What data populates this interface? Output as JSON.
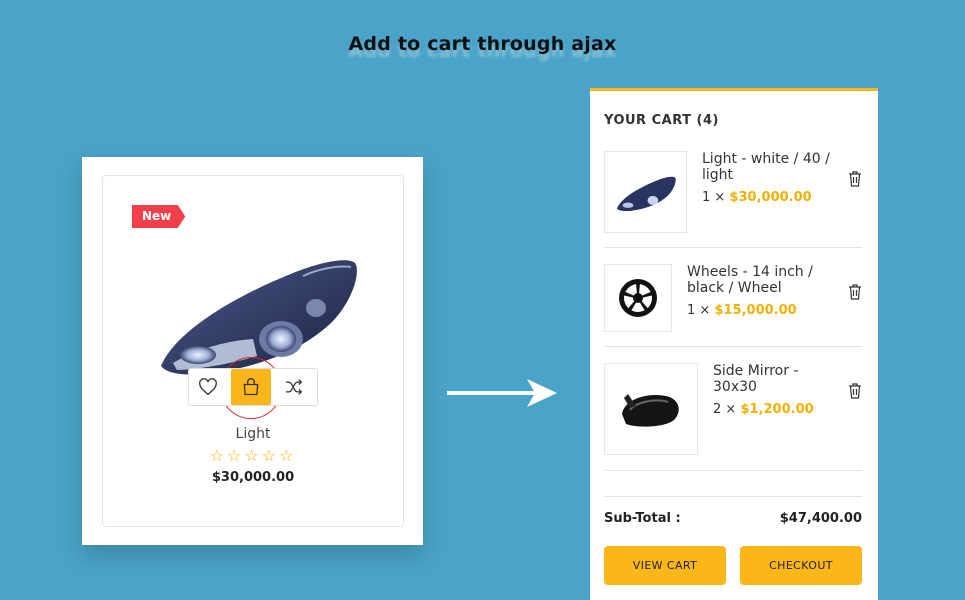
{
  "headline": "Add to cart through ajax",
  "product": {
    "badge": "New",
    "name": "Light",
    "stars": "☆☆☆☆☆",
    "price": "$30,000.00",
    "rating": 0,
    "actions": [
      "heart-icon",
      "shopping-bag-icon",
      "shuffle-icon"
    ]
  },
  "cart": {
    "title": "YOUR CART (4)",
    "items": [
      {
        "name": "Light - white / 40 / light",
        "qty": "1",
        "times": "×",
        "price": "$30,000.00",
        "image": "headlight"
      },
      {
        "name": "Wheels - 14 inch / black / Wheel",
        "qty": "1",
        "times": "×",
        "price": "$15,000.00",
        "image": "wheel"
      },
      {
        "name": "Side Mirror - 30x30",
        "qty": "2",
        "times": "×",
        "price": "$1,200.00",
        "image": "side-mirror"
      }
    ],
    "subtotal_label": "Sub-Total :",
    "subtotal_value": "$47,400.00",
    "view_cart_label": "VIEW CART",
    "checkout_label": "CHECKOUT"
  },
  "colors": {
    "background": "#4aa3c8",
    "accent": "#fbb61a",
    "badge": "#f2404a",
    "price_highlight": "#f3b000"
  }
}
